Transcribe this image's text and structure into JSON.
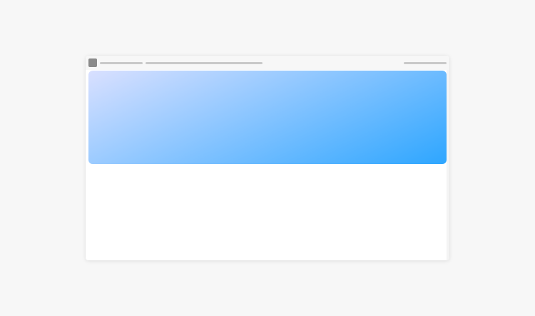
{
  "colors": {
    "page_background": "#f7f7f7",
    "window_background": "#ffffff",
    "titlebar_background": "#f7f7f7",
    "app_icon": "#8a8a8a",
    "placeholder_bar": "#c9c9c9",
    "hero_gradient_start": "#d9e0ff",
    "hero_gradient_end": "#2ea6ff"
  },
  "icons": {
    "app": "app-icon"
  }
}
